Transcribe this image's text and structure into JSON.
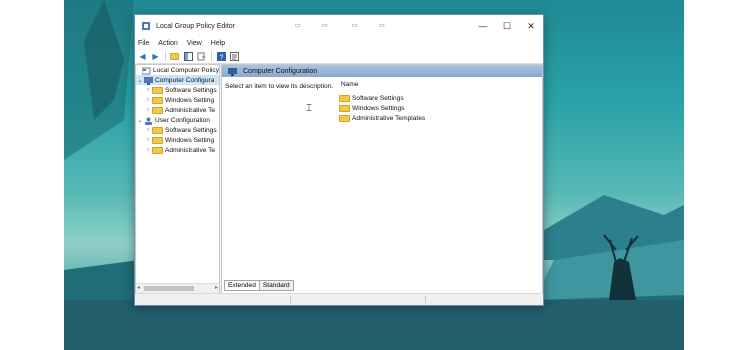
{
  "window": {
    "title": "Local Group Policy Editor",
    "controls": {
      "minimize": "—",
      "maximize": "☐",
      "close": "✕"
    }
  },
  "menu": [
    "File",
    "Action",
    "View",
    "Help"
  ],
  "tree": {
    "root": "Local Computer Policy",
    "computer": {
      "label": "Computer Configura",
      "children": [
        "Software Settings",
        "Windows Setting",
        "Administrative Te"
      ]
    },
    "user": {
      "label": "User Configuration",
      "children": [
        "Software Settings",
        "Windows Setting",
        "Administrative Te"
      ]
    }
  },
  "main": {
    "header": "Computer Configuration",
    "description": "Select an item to view its description.",
    "column_name": "Name",
    "items": [
      "Software Settings",
      "Windows Settings",
      "Administrative Templates"
    ]
  },
  "tabs": [
    "Extended",
    "Standard"
  ],
  "colors": {
    "header_bar": "#88a9cf",
    "folder": "#f2c94c",
    "desktop_sky": "#2aa2a8"
  }
}
